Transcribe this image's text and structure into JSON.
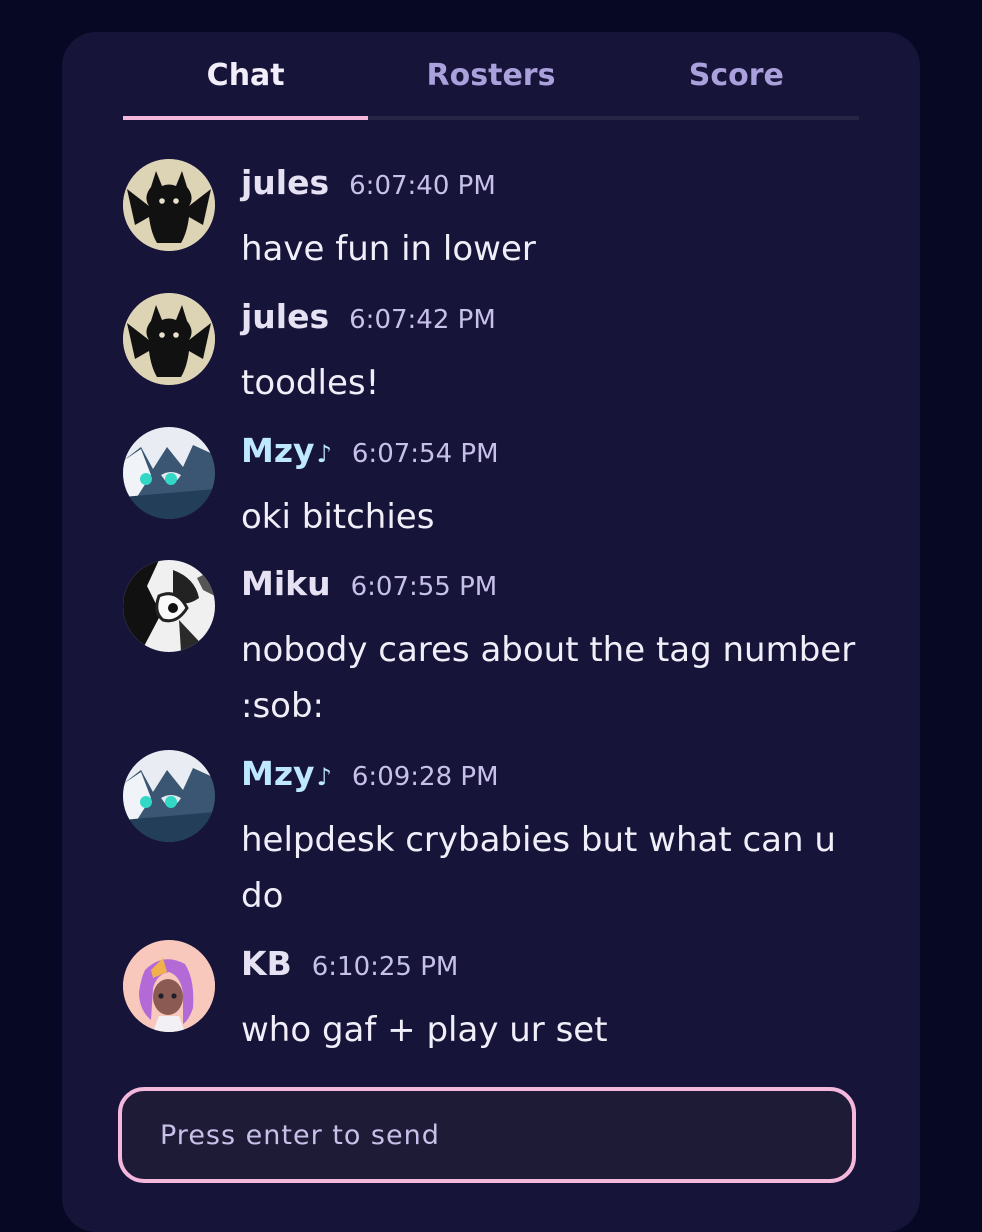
{
  "tabs": [
    {
      "label": "Chat"
    },
    {
      "label": "Rosters"
    },
    {
      "label": "Score"
    }
  ],
  "messages": [
    {
      "user": "jules",
      "time": "6:07:40 PM",
      "text": "have fun in lower",
      "avatar_icon": "black-cat-avatar"
    },
    {
      "user": "jules",
      "time": "6:07:42 PM",
      "text": "toodles!",
      "avatar_icon": "black-cat-avatar"
    },
    {
      "user": "Mzy",
      "note": "♪",
      "time": "6:07:54 PM",
      "text": "oki bitchies",
      "avatar_icon": "white-anime-avatar"
    },
    {
      "user": "Miku",
      "time": "6:07:55 PM",
      "text": "nobody cares about the tag number :sob:",
      "avatar_icon": "monochrome-art-avatar"
    },
    {
      "user": "Mzy",
      "note": "♪",
      "time": "6:09:28 PM",
      "text": "helpdesk crybabies but what can u do",
      "avatar_icon": "white-anime-avatar"
    },
    {
      "user": "KB",
      "time": "6:10:25 PM",
      "text": "who gaf + play ur set",
      "avatar_icon": "purple-hair-avatar"
    }
  ],
  "composer": {
    "placeholder": "Press enter to send"
  },
  "colors": {
    "background": "#070823",
    "panel": "#17143a",
    "accent": "#f4b8dd",
    "muted_text": "#a9a0dc",
    "teal_name": "#bde8ff"
  }
}
